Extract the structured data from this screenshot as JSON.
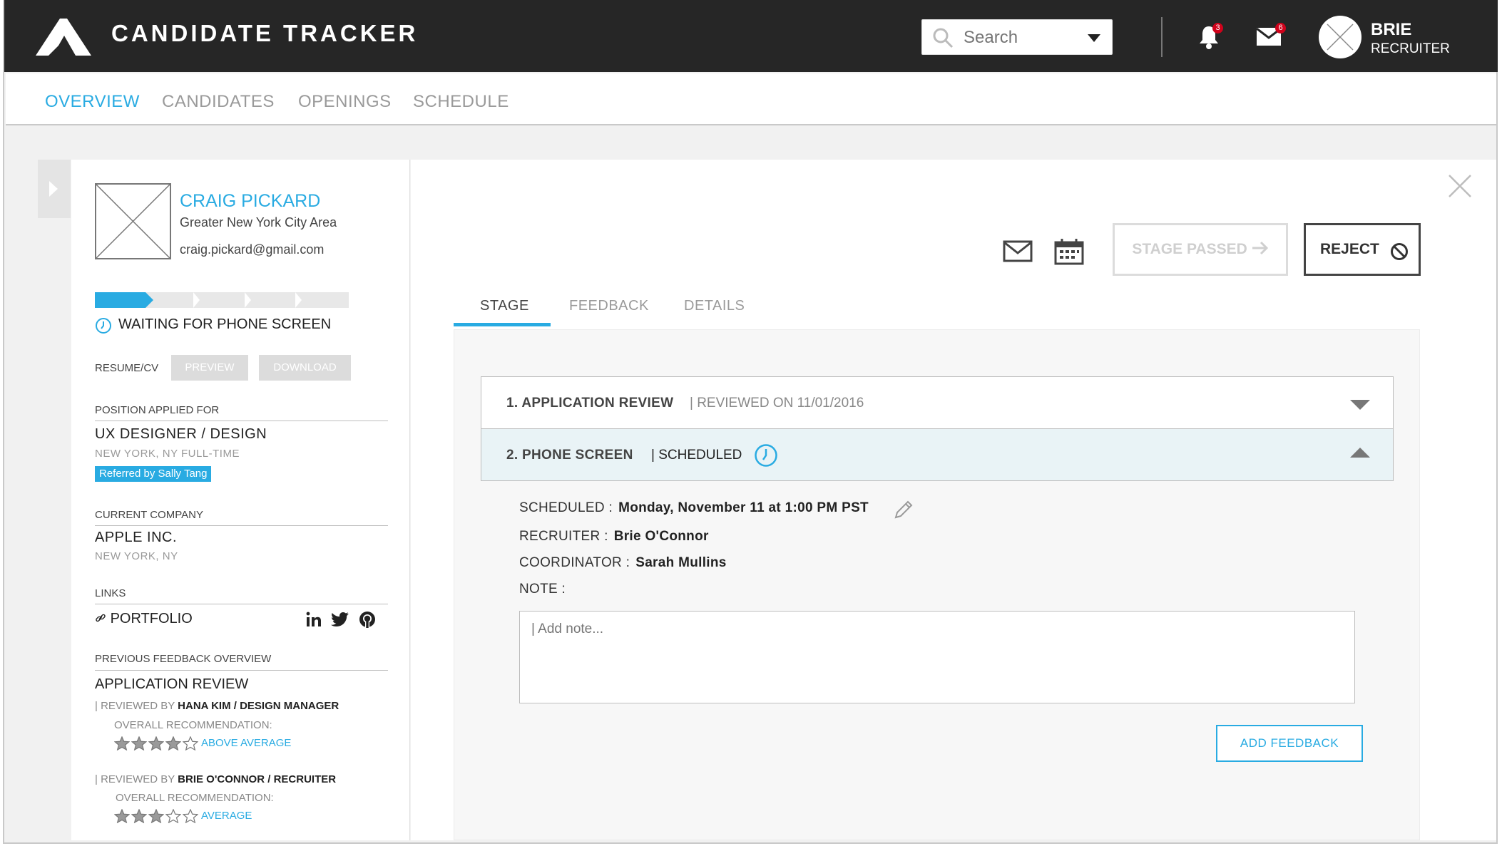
{
  "header": {
    "app_title": "CANDIDATE TRACKER",
    "search_placeholder": "Search",
    "notifications_count": "3",
    "messages_count": "6",
    "user_name": "BRIE",
    "user_role": "RECRUITER"
  },
  "nav": {
    "tabs": [
      {
        "label": "OVERVIEW",
        "active": true
      },
      {
        "label": "CANDIDATES",
        "active": false
      },
      {
        "label": "OPENINGS",
        "active": false
      },
      {
        "label": "SCHEDULE",
        "active": false
      }
    ]
  },
  "candidate": {
    "name": "CRAIG PICKARD",
    "location": "Greater New York City Area",
    "email": "craig.pickard@gmail.com",
    "progress_stage": 1,
    "progress_total": 5,
    "status": "WAITING FOR PHONE SCREEN",
    "resume_label": "RESUME/CV",
    "preview_label": "PREVIEW",
    "download_label": "DOWNLOAD",
    "position_section": "POSITION APPLIED FOR",
    "position": "UX DESIGNER / DESIGN",
    "position_meta": "NEW YORK, NY  FULL-TIME",
    "referral": "Referred by Sally Tang",
    "company_section": "CURRENT COMPANY",
    "company": "APPLE INC.",
    "company_location": "NEW YORK, NY",
    "links_section": "LINKS",
    "portfolio": "PORTFOLIO",
    "feedback_section": "PREVIOUS FEEDBACK OVERVIEW",
    "feedback_title": "APPLICATION REVIEW",
    "reviews": [
      {
        "prefix": "| REVIEWED BY",
        "reviewer": "HANA KIM / DESIGN MANAGER",
        "label": "OVERALL RECOMMENDATION:",
        "stars": 4,
        "rating": "ABOVE AVERAGE"
      },
      {
        "prefix": "| REVIEWED BY",
        "reviewer": "BRIE O'CONNOR / RECRUITER",
        "label": "OVERALL RECOMMENDATION:",
        "stars": 3,
        "rating": "AVERAGE"
      }
    ]
  },
  "actions": {
    "stage_passed": "STAGE PASSED",
    "reject": "REJECT"
  },
  "stage_tabs": [
    {
      "label": "STAGE",
      "active": true
    },
    {
      "label": "FEEDBACK",
      "active": false
    },
    {
      "label": "DETAILS",
      "active": false
    }
  ],
  "stages": [
    {
      "title": "1. APPLICATION REVIEW",
      "status": "| REVIEWED ON 11/01/2016"
    },
    {
      "title": "2. PHONE SCREEN",
      "status": "| SCHEDULED"
    }
  ],
  "phone_screen": {
    "scheduled_label": "SCHEDULED :",
    "scheduled_value": "Monday, November 11 at 1:00 PM PST",
    "recruiter_label": "RECRUITER :",
    "recruiter_value": "Brie O'Connor",
    "coordinator_label": "COORDINATOR :",
    "coordinator_value": "Sarah Mullins",
    "note_label": "NOTE :",
    "note_placeholder": "| Add note...",
    "add_feedback": "ADD FEEDBACK"
  },
  "colors": {
    "accent": "#29abe2",
    "topbar": "#262626",
    "badge": "#d0021b"
  }
}
